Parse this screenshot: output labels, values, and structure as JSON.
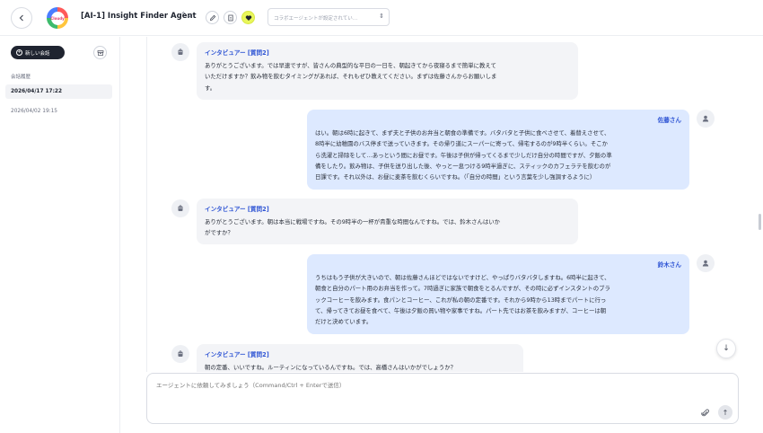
{
  "header": {
    "logo_text": "Cloudy",
    "agent_title": "[AI-1] Insight Finder Agent",
    "collab_placeholder": "コラボエージェントが設定されてい…"
  },
  "sidebar": {
    "new_chat_label": "新しい会話",
    "history_label": "会話履歴",
    "history": [
      {
        "label": "2026/04/17 17:22",
        "active": true
      },
      {
        "label": "2026/04/02 19:15",
        "active": false
      }
    ]
  },
  "messages": [
    {
      "role": "agent",
      "sender": "インタビュアー [質問2]",
      "lines": [
        "ありがとうございます。では早速ですが、皆さんの典型的な平日の一日を、朝起きてから夜寝るまで簡単に教えて",
        "いただけますか？飲み物を飲むタイミングがあれば、それもぜひ教えてください。まずは佐藤さんからお願いしま",
        "す。"
      ]
    },
    {
      "role": "user",
      "sender": "佐藤さん",
      "lines": [
        "はい。朝は6時に起きて、まず夫と子供のお弁当と朝食の準備です。バタバタと子供に食べさせて、着替えさせて、",
        "8時半に幼稚園のバス停まで送っていきます。その帰り道にスーパーに寄って、帰宅するのが9時半くらい。そこか",
        "ら洗濯と掃除をして…あっという間にお昼です。午後は子供が帰ってくるまで少しだけ自分の時間ですが、夕飯の準",
        "備をしたり。飲み物は、子供を送り出した後、やっと一息つける9時半過ぎに、スティックのカフェラテを飲むのが",
        "日課です。それ以外は、お昼に麦茶を飲むくらいですね。（「自分の時間」という言葉を少し強調するように）"
      ]
    },
    {
      "role": "agent",
      "sender": "インタビュアー [質問2]",
      "lines": [
        "ありがとうございます。朝は本当に戦場ですね。その9時半の一杯が貴重な時間なんですね。では、鈴木さんはいか",
        "がですか？"
      ]
    },
    {
      "role": "user",
      "sender": "鈴木さん",
      "lines": [
        "うちはもう子供が大きいので、朝は佐藤さんほどではないですけど、やっぱりバタバタしますね。6時半に起きて、",
        "朝食と自分のパート用のお弁当を作って。7時過ぎに家族で朝食をとるんですが、その時に必ずインスタントのブラ",
        "ックコーヒーを飲みます。食パンとコーヒー、これが私の朝の定番です。それから9時から13時までパートに行っ",
        "て、帰ってきてお昼を食べて、午後は夕飯の買い物や家事ですね。パート先ではお茶を飲みますが、コーヒーは朝",
        "だけと決めています。"
      ]
    },
    {
      "role": "agent",
      "sender": "インタビュアー [質問2]",
      "lines": [
        "朝の定番、いいですね。ルーティンになっているんですね。では、高橋さんはいかがでしょうか？"
      ]
    }
  ],
  "composer": {
    "placeholder": "エージェントに依頼してみましょう（Command/Ctrl + Enterで送信）"
  }
}
